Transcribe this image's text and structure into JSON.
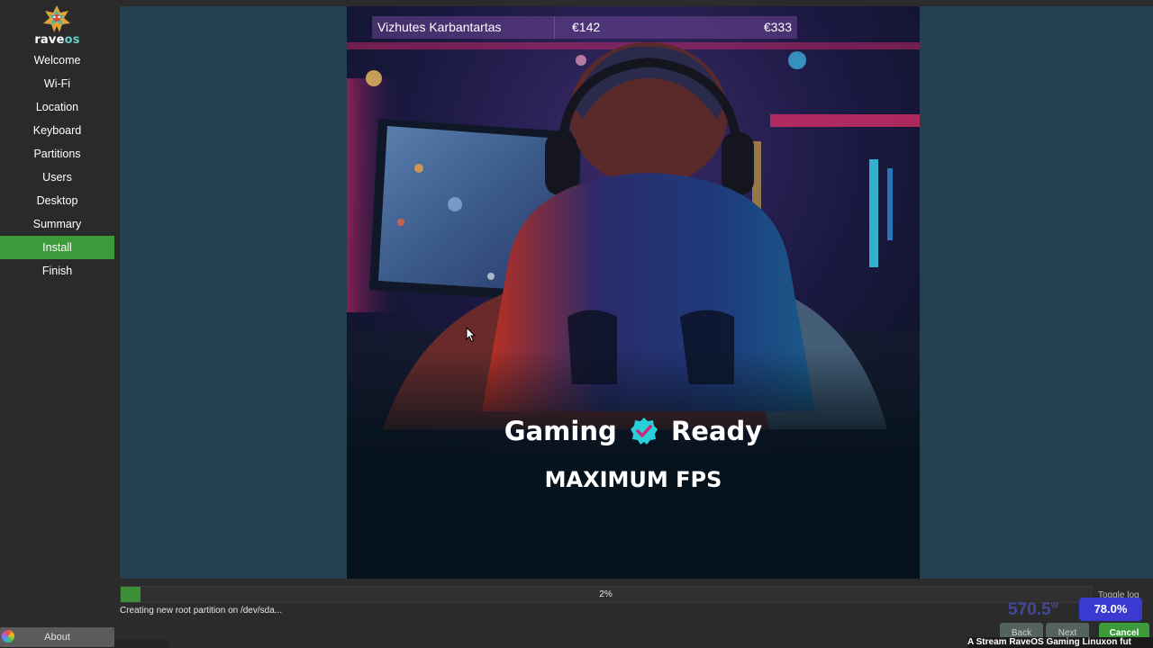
{
  "app": {
    "logo_text_a": "rave",
    "logo_text_b": "os"
  },
  "sidebar": {
    "items": [
      {
        "label": "Welcome",
        "active": false
      },
      {
        "label": "Wi-Fi",
        "active": false
      },
      {
        "label": "Location",
        "active": false
      },
      {
        "label": "Keyboard",
        "active": false
      },
      {
        "label": "Partitions",
        "active": false
      },
      {
        "label": "Users",
        "active": false
      },
      {
        "label": "Desktop",
        "active": false
      },
      {
        "label": "Summary",
        "active": false
      },
      {
        "label": "Install",
        "active": true
      },
      {
        "label": "Finish",
        "active": false
      }
    ],
    "about_label": "About"
  },
  "slide": {
    "product_name": "Vizhutes Karbantartas",
    "price_old": "€142",
    "price_new": "€333",
    "headline_left": "Gaming",
    "headline_right": "Ready",
    "subhead": "MAXIMUM FPS"
  },
  "progress": {
    "percent_value": 2,
    "percent_label": "2%",
    "status_text": "Creating new root partition on /dev/sda..."
  },
  "footer": {
    "toggle_log_label": "Toggle log",
    "overlay_number": "570.5",
    "overlay_unit": "W",
    "overlay_percent": "78.0%",
    "back_label": "Back",
    "next_label": "Next",
    "cancel_label": "Cancel",
    "ticker_text": "A Stream RaveOS Gaming Linuxon fut"
  },
  "colors": {
    "accent_green": "#3c9a3a",
    "main_bg": "#24414f",
    "sidebar_bg": "#2a2a2a"
  }
}
